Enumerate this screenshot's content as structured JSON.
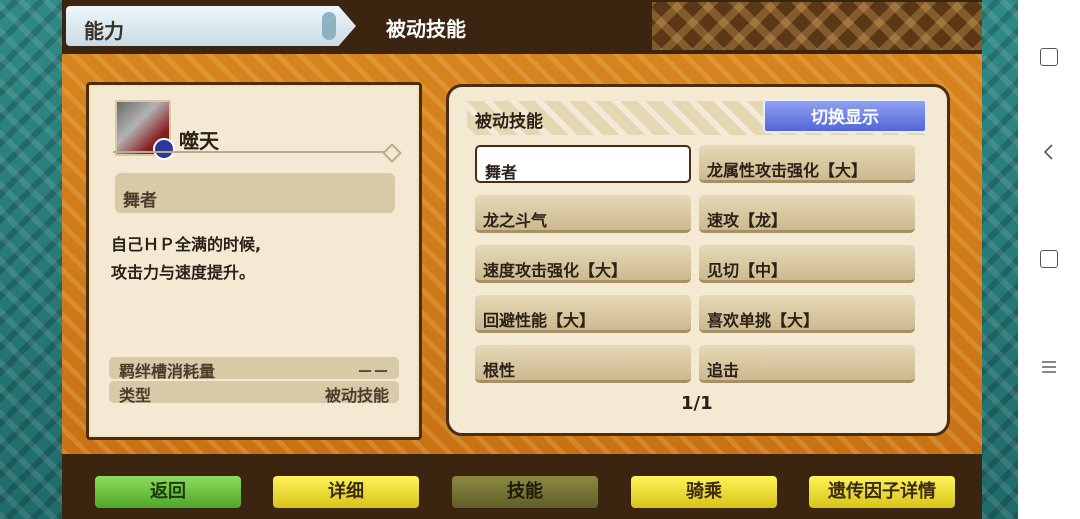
{
  "header": {
    "tab_label": "能力",
    "section_title": "被动技能"
  },
  "monster": {
    "name": "噬天"
  },
  "selected_skill": {
    "name": "舞者",
    "description_lines": [
      "自己ＨＰ全满的时候,",
      "攻击力与速度提升。"
    ],
    "bond_cost_label": "羁绊槽消耗量",
    "bond_cost_value": "－－",
    "type_label": "类型",
    "type_value": "被动技能"
  },
  "skill_panel": {
    "title": "被动技能",
    "toggle_label": "切换显示",
    "skills": [
      "舞者",
      "龙属性攻击强化【大】",
      "龙之斗气",
      "速攻【龙】",
      "速度攻击强化【大】",
      "见切【中】",
      "回避性能【大】",
      "喜欢单挑【大】",
      "根性",
      "追击"
    ],
    "selected_index": 0,
    "page": "1/1"
  },
  "bottom_menu": {
    "back": "返回",
    "detail": "详细",
    "skill": "技能",
    "ride": "骑乘",
    "gene": "遗传因子详情"
  },
  "system_nav": {
    "icons": [
      "fullscreen-icon",
      "back-icon",
      "home-square-icon",
      "menu-icon"
    ]
  }
}
